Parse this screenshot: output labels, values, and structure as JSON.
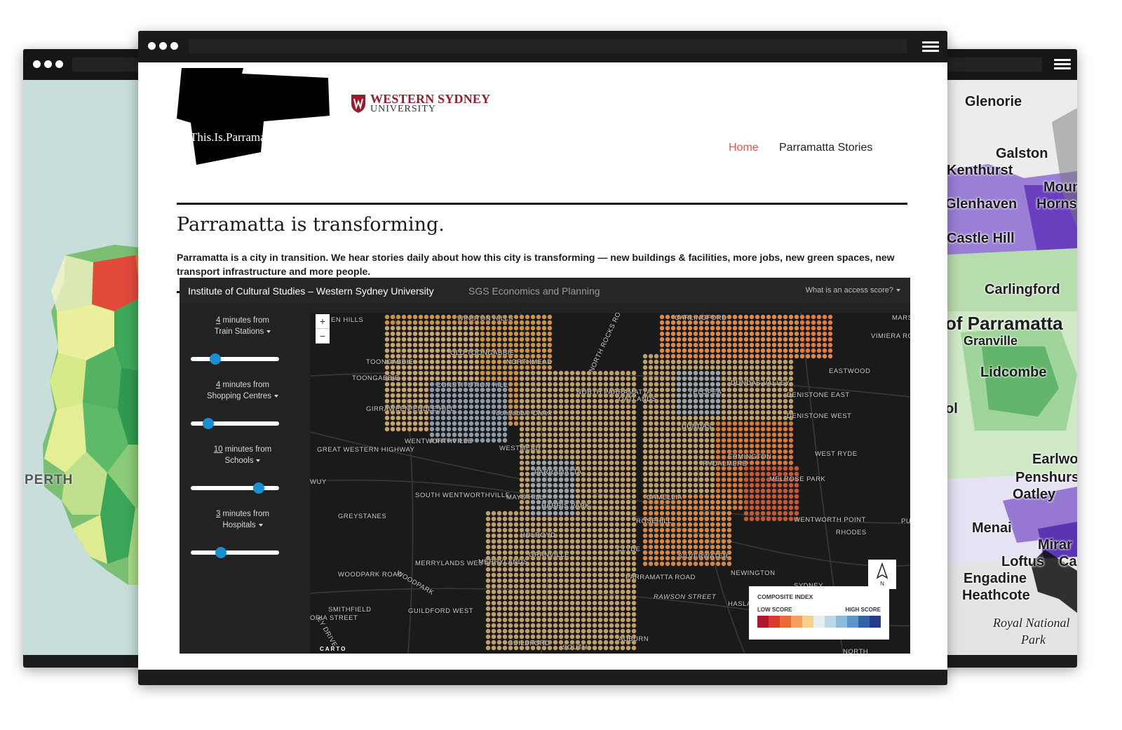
{
  "left_window": {
    "map_label": "PERTH"
  },
  "right_window": {
    "places": [
      "Glenorie",
      "Galston",
      "Kenthurst",
      "Mount",
      "Glenhaven",
      "Horns",
      "Castle Hill",
      "Carlingford",
      "of Parramatta",
      "Granville",
      "Lidcombe",
      "ol",
      "Earlwo",
      "Penshurs",
      "Oatley",
      "Menai",
      "Mirar",
      "Loftus",
      "Ca",
      "Engadine",
      "Heathcote",
      "Royal National",
      "Park"
    ]
  },
  "site": {
    "logo_text": "This.Is.Parramatta.",
    "partner_logo": {
      "line1": "WESTERN SYDNEY",
      "line2": "UNIVERSITY"
    },
    "nav": {
      "home": "Home",
      "stories": "Parramatta Stories"
    },
    "title": "Parramatta is transforming.",
    "intro": "Parramatta is a city in transition.  We hear stories daily about how this city is transforming — new buildings & facilities, more jobs, new green spaces, new transport infrastructure and more people."
  },
  "app": {
    "title": "Institute of Cultural Studies – Western Sydney University",
    "subtitle": "SGS Economics and Planning",
    "help_link": "What is an access score?",
    "controls": [
      {
        "minutes": "4",
        "suffix": " minutes from",
        "target": "Train Stations",
        "level": 0.28
      },
      {
        "minutes": "4",
        "suffix": " minutes from",
        "target": "Shopping Centres",
        "level": 0.2
      },
      {
        "minutes": "10",
        "suffix": " minutes from",
        "target": "Schools",
        "level": 0.77
      },
      {
        "minutes": "3",
        "suffix": " minutes from",
        "target": "Hospitals",
        "level": 0.34
      }
    ],
    "zoom": {
      "in": "+",
      "out": "−"
    },
    "map_labels": [
      "EN HILLS",
      "WINSTON HILLS",
      "CARLINGFORD",
      "MARSF",
      "VIMIERA ROAD",
      "NORTH ROCKS ROAD",
      "OLD TOONGABBIE",
      "TOONGABBIE",
      "NORTHMEAD",
      "EASTWOOD",
      "TOONGABBIE",
      "CONSTITUTION HILL",
      "NORTH PARRAMATTA",
      "OATLANDS",
      "TELOPEA",
      "DUNDAS VALLEY",
      "DENISTONE EAST",
      "GIRRAWEEN",
      "PENDLE HILL",
      "Toongabbie Creek",
      "DENISTONE WEST",
      "GREAT WESTERN HIGHWAY",
      "WENTWORTHVILLE",
      "DUNDAS",
      "WESTMEAD",
      "WEST RYDE",
      "ERMINGTON",
      "RYDALMERE",
      "PARRAMATTA",
      "WUY",
      "MELROSE PARK",
      "SOUTH WENTWORTHVILLE",
      "MAYS HILL",
      "CAMELLIA",
      "GREYSTANES",
      "HARRIS PARK",
      "ROSEHILL",
      "WENTWORTH POINT",
      "RHODES",
      "PUT",
      "HOLROYD",
      "SILVERWATER",
      "CLYDE",
      "GRANVILLE",
      "MERRYLANDS WEST",
      "MERRYLANDS",
      "NEWINGTON",
      "WOODPARK ROAD",
      "WOODPARK",
      "PARRAMATTA ROAD",
      "SYDNEY",
      "SMITHFIELD",
      "GUILDFORD WEST",
      "Haslams Creek",
      "RAWSON STREET",
      "ORIA STREET",
      "EY DRIVE",
      "GUILDFORD",
      "AUBURN",
      "SOUTH",
      "NORTH"
    ],
    "legend": {
      "title": "COMPOSITE INDEX",
      "low": "LOW SCORE",
      "high": "HIGH SCORE",
      "colors": [
        "#b0172f",
        "#d63b2d",
        "#ea6a36",
        "#f4a05a",
        "#f9d089",
        "#e9eef2",
        "#bcd7e8",
        "#8dbbdc",
        "#5b95c9",
        "#2f62a8",
        "#233d8c"
      ]
    },
    "north_label": "N",
    "carto": "CARTO"
  }
}
